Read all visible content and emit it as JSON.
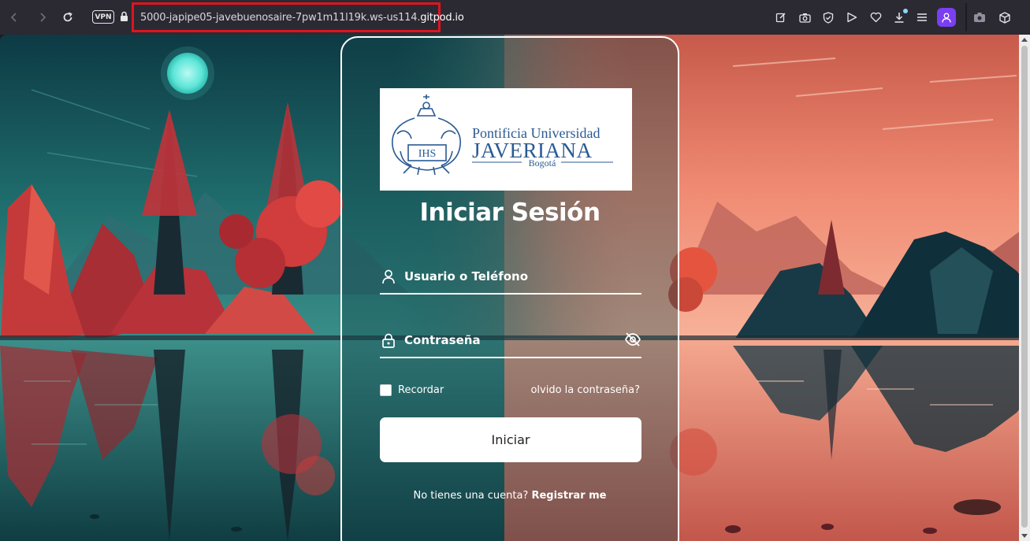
{
  "browser": {
    "vpn_label": "VPN",
    "url_prefix": "5000-japipe05-javebuenosaire-7pw1m11l19k.ws-us114.",
    "url_domain": "gitpod.io"
  },
  "login": {
    "logo": {
      "line1": "Pontificia Universidad",
      "line2": "JAVERIANA",
      "line3": "Bogotá",
      "seal_text": "IHS"
    },
    "title": "Iniciar Sesión",
    "username_label": "Usuario o Teléfono",
    "password_label": "Contraseña",
    "remember_label": "Recordar",
    "forgot_label": "olvido la contraseña?",
    "submit_label": "Iniciar",
    "register_question": "No tienes una cuenta?",
    "register_link": "Registrar me"
  },
  "colors": {
    "accent": "#7b3ff2",
    "highlight_border": "#e0131f",
    "logo_blue": "#1f4e8c"
  }
}
